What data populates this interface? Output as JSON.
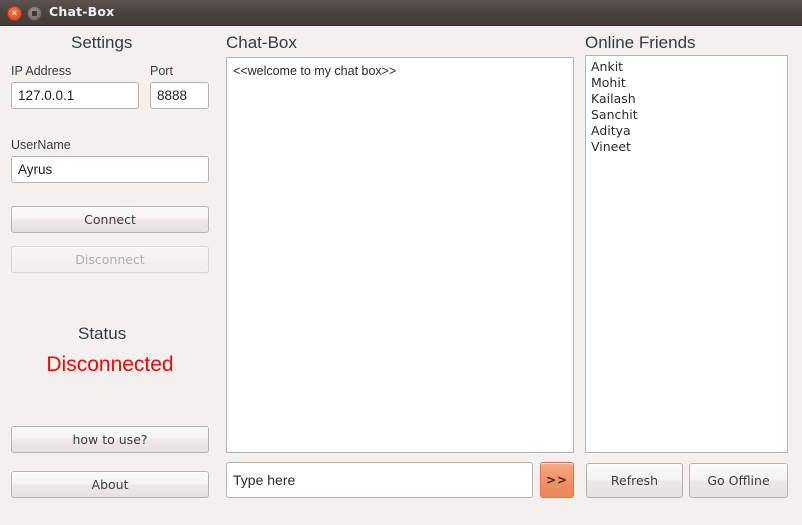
{
  "window": {
    "title": "Chat-Box",
    "close_icon": "close-icon",
    "maximize_icon": "maximize-icon",
    "close_glyph": "×"
  },
  "settings": {
    "heading": "Settings",
    "ip_label": "IP Address",
    "ip_value": "127.0.0.1",
    "port_label": "Port",
    "port_value": "8888",
    "username_label": "UserName",
    "username_value": "Ayrus",
    "connect_label": "Connect",
    "disconnect_label": "Disconnect",
    "status_heading": "Status",
    "status_value": "Disconnected",
    "status_color": "#fe0000",
    "how_to_use_label": "how to use?",
    "about_label": "About"
  },
  "chat": {
    "heading": "Chat-Box",
    "messages": [
      "<<welcome to my chat box>>"
    ],
    "input_value": "Type here",
    "send_label": ">>",
    "send_color": "#f09468"
  },
  "friends": {
    "heading": "Online Friends",
    "items": [
      "Ankit",
      "Mohit",
      "Kailash",
      "Sanchit",
      "Aditya",
      "Vineet"
    ],
    "refresh_label": "Refresh",
    "go_offline_label": "Go Offline"
  }
}
